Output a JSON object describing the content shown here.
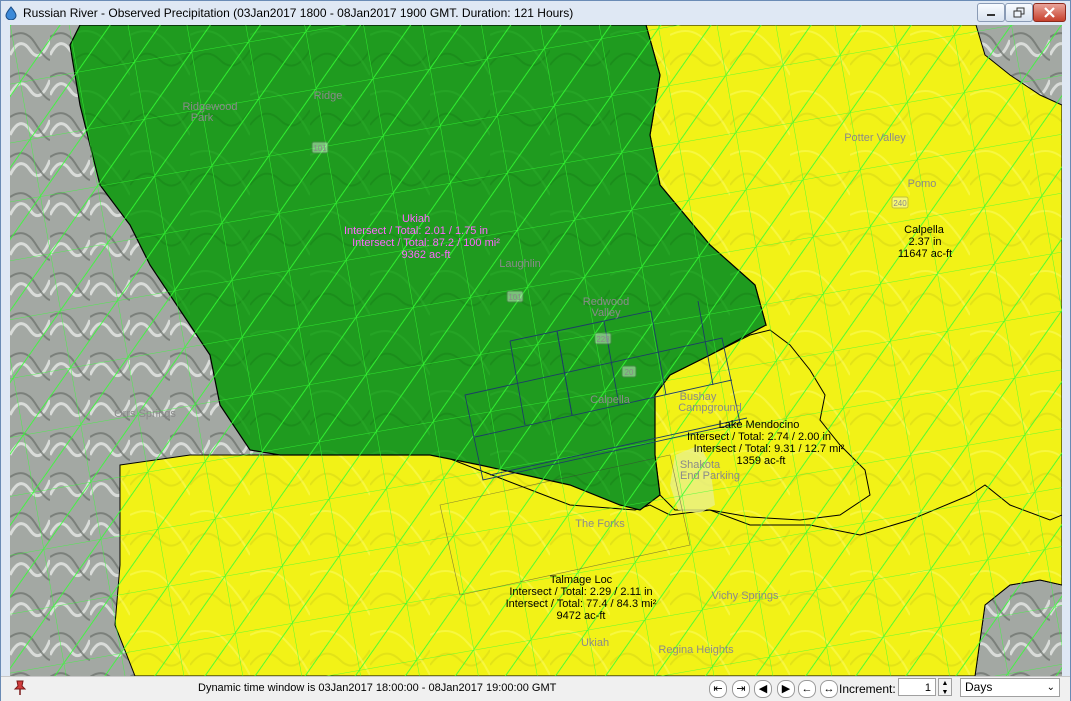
{
  "window": {
    "title": "Russian River - Observed Precipitation (03Jan2017 1800 - 08Jan2017 1900 GMT.  Duration: 121 Hours)"
  },
  "map": {
    "colors": {
      "ukiah": "#1f9b1f",
      "surrounding": "#f2f217",
      "grid_line": "#33ff33",
      "dark_grid": "#1c3f66",
      "terrain": "#9aa09a",
      "boundary": "#000000"
    },
    "basins": [
      {
        "name": "Ukiah",
        "lines": [
          "Intersect / Total: 2.01 / 1.75 in",
          "Intersect / Total: 87.2 / 100 mi²",
          "9362 ac-ft"
        ],
        "color": "pink"
      },
      {
        "name": "Calpella",
        "lines": [
          "2.37 in",
          "11647 ac-ft"
        ],
        "color": "black"
      },
      {
        "name": "Lake Mendocino",
        "lines": [
          "Intersect / Total: 2.74 / 2.00 in",
          "Intersect / Total: 9.31 / 12.7 mi²",
          "1359 ac-ft"
        ],
        "color": "black"
      },
      {
        "name": "Talmage Loc",
        "lines": [
          "Intersect / Total: 2.29 / 2.11 in",
          "Intersect / Total: 77.4 / 84.3 mi²",
          "9472 ac-ft"
        ],
        "color": "black"
      }
    ],
    "places": [
      "Ridgewood",
      "Park",
      "Ridge",
      "Potter Valley",
      "Pomo",
      "Laughlin",
      "Redwood",
      "Valley",
      "Calpella",
      "Orrs Springs",
      "Bushay",
      "Campground",
      "Shakota",
      "End Parking",
      "The Forks",
      "Vichy Springs",
      "Ukiah",
      "Regina Heights"
    ],
    "road_shields": [
      "101",
      "101",
      "240",
      "228",
      "20"
    ]
  },
  "status": {
    "text": "Dynamic time window is 03Jan2017 18:00:00 - 08Jan2017 19:00:00 GMT",
    "increment_label": "Increment:",
    "increment_value": "1",
    "unit": "Days",
    "nav_buttons": [
      "first",
      "last",
      "prev",
      "next",
      "back",
      "forward"
    ]
  }
}
